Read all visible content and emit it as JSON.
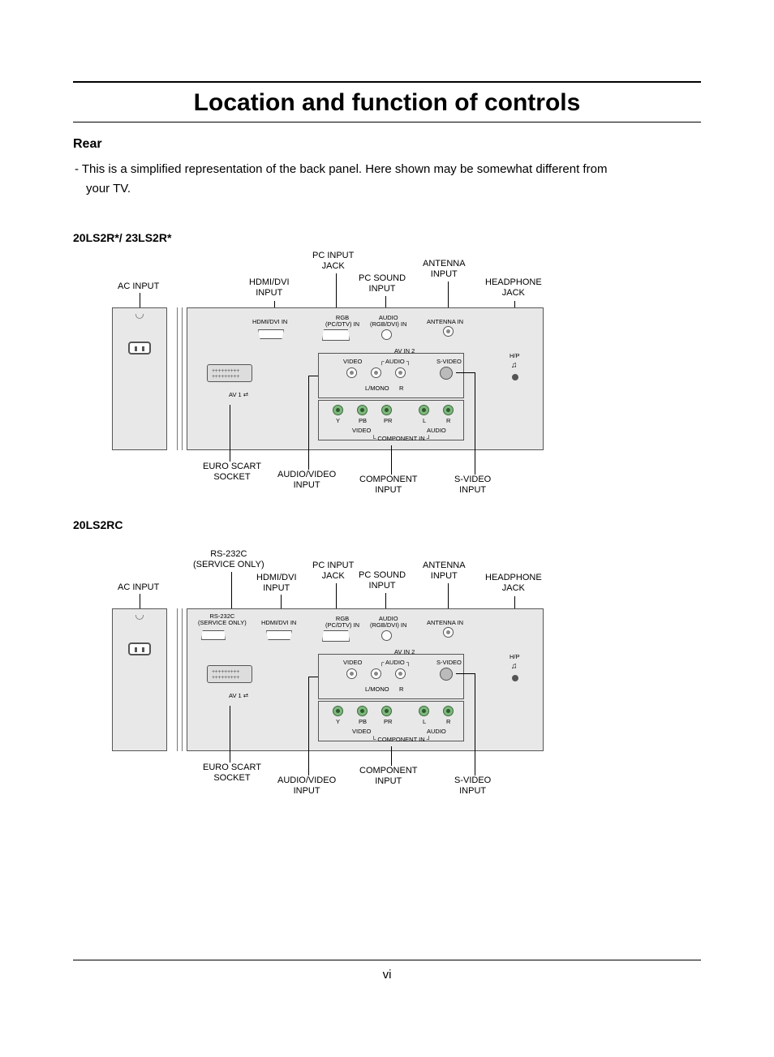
{
  "title": "Location and function of controls",
  "subhead": "Rear",
  "body_line1": "- This is a simplified representation of the back panel. Here shown may be somewhat different from",
  "body_line2": "your TV.",
  "page_number": "vi",
  "diagram1": {
    "model": "20LS2R*/ 23LS2R*",
    "callouts": {
      "ac_input": "AC INPUT",
      "hdmi_dvi_input_l1": "HDMI/DVI",
      "hdmi_dvi_input_l2": "INPUT",
      "pc_input_l1": "PC INPUT",
      "pc_input_l2": "JACK",
      "pc_sound_l1": "PC SOUND",
      "pc_sound_l2": "INPUT",
      "antenna_l1": "ANTENNA",
      "antenna_l2": "INPUT",
      "headphone_l1": "HEADPHONE",
      "headphone_l2": "JACK",
      "euro_scart_l1": "EURO SCART",
      "euro_scart_l2": "SOCKET",
      "av_input_l1": "AUDIO/VIDEO",
      "av_input_l2": "INPUT",
      "component_l1": "COMPONENT",
      "component_l2": "INPUT",
      "svideo_l1": "S-VIDEO",
      "svideo_l2": "INPUT"
    },
    "panel": {
      "hdmi_dvi_in": "HDMI/DVI IN",
      "rgb_l1": "RGB",
      "rgb_l2": "(PC/DTV) IN",
      "audio_l1": "AUDIO",
      "audio_l2": "(RGB/DVI) IN",
      "antenna_in": "ANTENNA IN",
      "av_in_2": "AV IN 2",
      "video": "VIDEO",
      "audio": "AUDIO",
      "s_video": "S-VIDEO",
      "hp": "H/P",
      "l_mono": "L/MONO",
      "r": "R",
      "y": "Y",
      "pb": "PB",
      "pr": "PR",
      "l": "L",
      "video2": "VIDEO",
      "audio2": "AUDIO",
      "component_in": "COMPONENT IN",
      "av1": "AV 1"
    }
  },
  "diagram2": {
    "model": "20LS2RC",
    "callouts": {
      "ac_input": "AC INPUT",
      "rs232_l1": "RS-232C",
      "rs232_l2": "(SERVICE ONLY)",
      "hdmi_dvi_input_l1": "HDMI/DVI",
      "hdmi_dvi_input_l2": "INPUT",
      "pc_input_l1": "PC INPUT",
      "pc_input_l2": "JACK",
      "pc_sound_l1": "PC SOUND",
      "pc_sound_l2": "INPUT",
      "antenna_l1": "ANTENNA",
      "antenna_l2": "INPUT",
      "headphone_l1": "HEADPHONE",
      "headphone_l2": "JACK",
      "euro_scart_l1": "EURO SCART",
      "euro_scart_l2": "SOCKET",
      "av_input_l1": "AUDIO/VIDEO",
      "av_input_l2": "INPUT",
      "component_l1": "COMPONENT",
      "component_l2": "INPUT",
      "svideo_l1": "S-VIDEO",
      "svideo_l2": "INPUT"
    },
    "panel": {
      "rs232_l1": "RS-232C",
      "rs232_l2": "(SERVICE ONLY)",
      "hdmi_dvi_in": "HDMI/DVI IN",
      "rgb_l1": "RGB",
      "rgb_l2": "(PC/DTV) IN",
      "audio_l1": "AUDIO",
      "audio_l2": "(RGB/DVI) IN",
      "antenna_in": "ANTENNA IN",
      "av_in_2": "AV IN 2",
      "video": "VIDEO",
      "audio": "AUDIO",
      "s_video": "S-VIDEO",
      "hp": "H/P",
      "l_mono": "L/MONO",
      "r": "R",
      "y": "Y",
      "pb": "PB",
      "pr": "PR",
      "l": "L",
      "video2": "VIDEO",
      "audio2": "AUDIO",
      "component_in": "COMPONENT IN",
      "av1": "AV 1"
    }
  }
}
